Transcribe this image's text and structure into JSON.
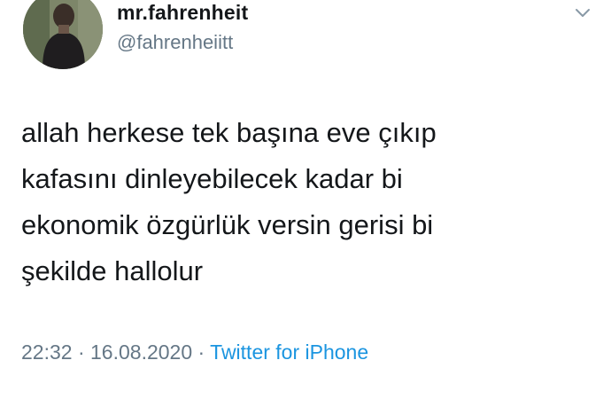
{
  "user": {
    "display_name": "mr.fahrenheit",
    "handle": "@fahrenheiitt"
  },
  "tweet": {
    "lines": [
      "allah herkese tek başına eve çıkıp",
      "kafasını dinleyebilecek kadar bi",
      "ekonomik özgürlük versin gerisi bi",
      "şekilde hallolur"
    ],
    "time": "22:32",
    "separator": " · ",
    "date": "16.08.2020",
    "source": "Twitter for iPhone"
  },
  "icons": {
    "more": "chevron-down-icon",
    "avatar": "avatar"
  },
  "colors": {
    "text": "#14171a",
    "secondary": "#657786",
    "link": "#1b95e0"
  }
}
